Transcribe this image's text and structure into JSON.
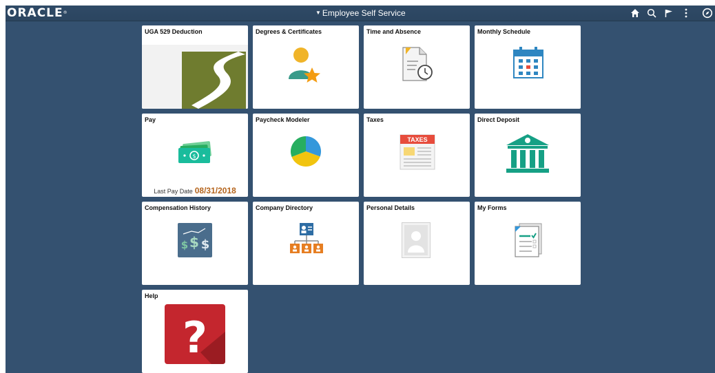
{
  "header": {
    "logo": "ORACLE",
    "title": "Employee Self Service"
  },
  "actions": [
    {
      "name": "home-button",
      "icon": "home-icon"
    },
    {
      "name": "search-button",
      "icon": "search-icon"
    },
    {
      "name": "notifications-button",
      "icon": "flag-icon"
    },
    {
      "name": "actions-menu-button",
      "icon": "more-vertical-icon"
    },
    {
      "name": "navbar-button",
      "icon": "compass-icon"
    }
  ],
  "tiles": [
    {
      "id": "uga-529-deduction",
      "title": "UGA 529 Deduction",
      "icon": "winding-road-logo-icon"
    },
    {
      "id": "degrees-certificates",
      "title": "Degrees & Certificates",
      "icon": "person-star-icon"
    },
    {
      "id": "time-and-absence",
      "title": "Time and Absence",
      "icon": "document-clock-icon"
    },
    {
      "id": "monthly-schedule",
      "title": "Monthly Schedule",
      "icon": "calendar-icon"
    },
    {
      "id": "pay",
      "title": "Pay",
      "icon": "money-icon",
      "last_pay_label": "Last Pay Date",
      "last_pay_date": "08/31/2018"
    },
    {
      "id": "paycheck-modeler",
      "title": "Paycheck Modeler",
      "icon": "pie-chart-icon"
    },
    {
      "id": "taxes",
      "title": "Taxes",
      "icon": "taxes-form-icon",
      "badge": "TAXES"
    },
    {
      "id": "direct-deposit",
      "title": "Direct Deposit",
      "icon": "bank-icon"
    },
    {
      "id": "compensation-history",
      "title": "Compensation History",
      "icon": "dollar-history-icon"
    },
    {
      "id": "company-directory",
      "title": "Company Directory",
      "icon": "org-chart-icon"
    },
    {
      "id": "personal-details",
      "title": "Personal Details",
      "icon": "person-placeholder-icon"
    },
    {
      "id": "my-forms",
      "title": "My Forms",
      "icon": "forms-checklist-icon"
    },
    {
      "id": "help",
      "title": "Help",
      "icon": "help-question-icon"
    }
  ],
  "colors": {
    "background": "#345170",
    "header": "#2d4763",
    "pay_date": "#b5651d",
    "help": "#c4262e"
  }
}
